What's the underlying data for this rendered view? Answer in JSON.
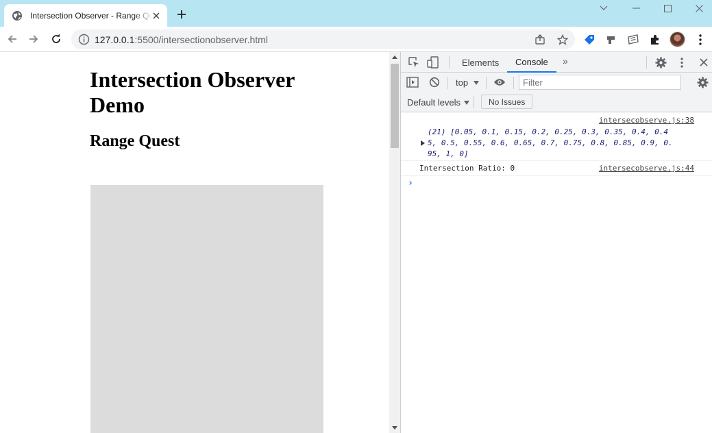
{
  "browser": {
    "tab": {
      "title": "Intersection Observer - Range Quest",
      "favicon": "globe-icon"
    },
    "url": {
      "host": "127.0.0.1",
      "rest": ":5500/intersectionobserver.html"
    }
  },
  "page": {
    "heading": "Intersection Observer Demo",
    "subheading": "Range Quest",
    "box_color": "#dcdcdc"
  },
  "devtools": {
    "tabs": [
      "Elements",
      "Console"
    ],
    "active_tab": "Console",
    "context": "top",
    "filter_placeholder": "Filter",
    "levels": "Default levels",
    "issues": "No Issues",
    "logs": [
      {
        "source": "intersecobserve.js:38",
        "lines": [
          "(21) [0.05, 0.1, 0.15, 0.2, 0.25, 0.3, 0.35, 0.4, 0.4",
          "5, 0.5, 0.55, 0.6, 0.65, 0.7, 0.75, 0.8, 0.85, 0.9, 0.",
          "95, 1, 0]"
        ]
      },
      {
        "source": "intersecobserve.js:44",
        "text": "Intersection Ratio: 0"
      }
    ],
    "prompt": "›"
  },
  "colors": {
    "titlebar": "#b8e5f2",
    "accent": "#1a73e8"
  }
}
